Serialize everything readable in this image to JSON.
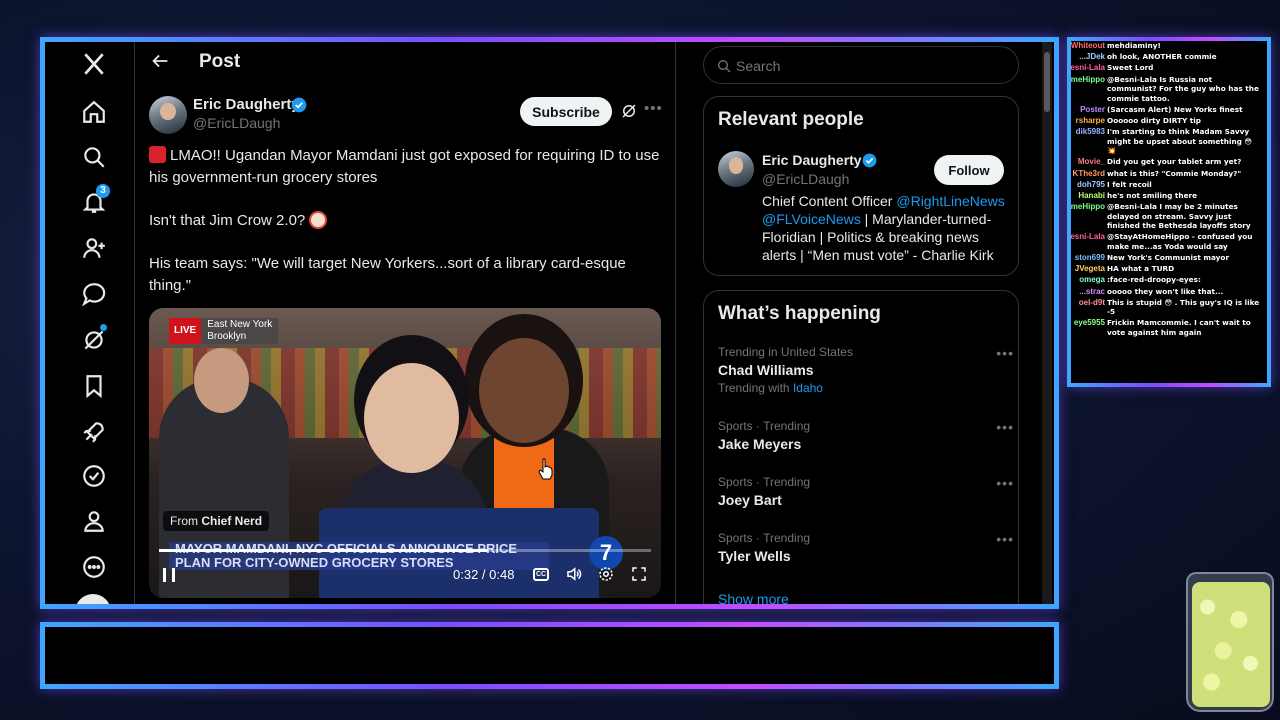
{
  "nav": {
    "notifications_badge": "3",
    "icons": [
      "x-logo-icon",
      "home-icon",
      "search-icon",
      "bell-icon",
      "people-icon",
      "chat-icon",
      "grok-icon",
      "bookmark-icon",
      "rocket-icon",
      "verified-icon",
      "profile-icon",
      "more-circle-icon"
    ]
  },
  "header": {
    "title": "Post"
  },
  "post": {
    "author_name": "Eric Daugherty",
    "author_handle": "@EricLDaugh",
    "subscribe_label": "Subscribe",
    "paragraph1": "LMAO!! Ugandan Mayor Mamdani just got exposed for requiring ID to use his government-run grocery stores",
    "paragraph2": "Isn't that Jim Crow 2.0?",
    "paragraph3": "His team says: \"We will target New Yorkers...sort of a library card-esque thing.\""
  },
  "video": {
    "live_label": "LIVE",
    "location_line1": "East New York",
    "location_line2": "Brooklyn",
    "from_prefix": "From",
    "from_source": "Chief Nerd",
    "ticker_line1": "MAYOR MAMDANI, NYC OFFICIALS ANNOUNCE PRICE",
    "ticker_line2": "PLAN FOR CITY-OWNED GROCERY STORES",
    "channel_logo": "7",
    "time": "0:32 / 0:48",
    "cc_label": "CC",
    "progress_fraction": 0.667
  },
  "search": {
    "placeholder": "Search"
  },
  "relevant_people": {
    "title": "Relevant people",
    "name": "Eric Daugherty",
    "handle": "@EricLDaugh",
    "follow_label": "Follow",
    "bio_part1": "Chief Content Officer ",
    "bio_link1": "@RightLineNews",
    "bio_link2": "@FLVoiceNews",
    "bio_part2": " | Marylander-turned-Floridian | Politics & breaking news alerts | “Men must vote” - Charlie Kirk"
  },
  "happening": {
    "title": "What’s happening",
    "trends": [
      {
        "meta": "Trending in United States",
        "name": "Chad Williams",
        "with_prefix": "Trending with",
        "with_link": "Idaho"
      },
      {
        "meta": "Sports · Trending",
        "name": "Jake Meyers"
      },
      {
        "meta": "Sports · Trending",
        "name": "Joey Bart"
      },
      {
        "meta": "Sports · Trending",
        "name": "Tyler Wells"
      }
    ],
    "show_more": "Show more",
    "more_label": "•••"
  },
  "chat": {
    "messages": [
      {
        "user": "Whiteout",
        "color": "#ff6b6b",
        "text": "mehdiaminy!"
      },
      {
        "user": "JDek...",
        "color": "#9ad0ff",
        "text": "oh look, ANOTHER commie"
      },
      {
        "user": "esni-Lala",
        "color": "#ff5fa2",
        "text": "Sweet Lord"
      },
      {
        "user": "meHippo",
        "color": "#7cff8a",
        "text": "@Besni-Lala Is Russia not communist? For the guy who has the commie tattoo."
      },
      {
        "user": "Poster",
        "color": "#c08bff",
        "text": "(Sarcasm Alert) New Yorks finest"
      },
      {
        "user": "rsharpe",
        "color": "#ffb347",
        "text": "Oooooo dirty DIRTY tip"
      },
      {
        "user": "dik5983",
        "color": "#8fb6ff",
        "text": "I'm starting to think Madam Savvy might be upset about something 😳 💥"
      },
      {
        "user": "_Movie",
        "color": "#ff7b7b",
        "text": "Did you get your tablet arm yet?"
      },
      {
        "user": "KThe3rd",
        "color": "#ff9d5c",
        "text": "what is this? \"Commie Monday?\""
      },
      {
        "user": "doh795",
        "color": "#9ecbff",
        "text": "I felt recoil"
      },
      {
        "user": "Hanabi",
        "color": "#b6ff6e",
        "text": "he's not smiling there"
      },
      {
        "user": "meHippo",
        "color": "#7cff8a",
        "text": "@Besni-Lala I may be 2 minutes delayed on stream. Savvy just finished the Bethesda layoffs story"
      },
      {
        "user": "esni-Lala",
        "color": "#ff5fa2",
        "text": "@StayAtHomeHippo - confused you make me...as Yoda would say"
      },
      {
        "user": "ston699",
        "color": "#6ec1ff",
        "text": "New York's Communist mayor"
      },
      {
        "user": "JVegeta",
        "color": "#ffd35c",
        "text": "HA what a TURD"
      },
      {
        "user": "omega",
        "color": "#7dffc9",
        "text": ":face-red-droopy-eyes:"
      },
      {
        "user": "strac...",
        "color": "#d08bff",
        "text": "ooooo they won't like that..."
      },
      {
        "user": "oel-d9t",
        "color": "#ff8f8f",
        "text": "This is stupid 😳 . This guy's IQ is like -5"
      },
      {
        "user": "eye5955",
        "color": "#8aff8a",
        "text": "Frickin Mamcommie. I can't wait to vote against him again"
      }
    ]
  },
  "colors": {
    "accent": "#1d9bf0",
    "background": "#000000",
    "live_red": "#d0121b"
  }
}
